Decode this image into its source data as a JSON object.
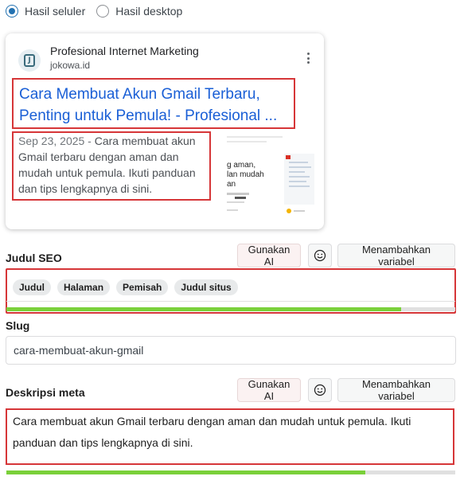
{
  "preview_mode": {
    "mobile_label": "Hasil seluler",
    "desktop_label": "Hasil desktop",
    "selected": "mobile"
  },
  "serp_card": {
    "site_name": "Profesional Internet Marketing",
    "site_url": "jokowa.id",
    "favicon_glyph": "J",
    "title": "Cara Membuat Akun Gmail Terbaru, Penting untuk Pemula! - Profesional ...",
    "date": "Sep 23, 2025",
    "separator": " - ",
    "description": "Cara membuat akun Gmail terbaru dengan aman dan mudah untuk pemula. Ikuti panduan dan tips lengkapnya di sini.",
    "thumb_lines": [
      "g aman,",
      "lan mudah",
      "an"
    ]
  },
  "seo_title": {
    "label": "Judul SEO",
    "ai_button": "Gunakan AI",
    "variable_button": "Menambahkan variabel",
    "tags": [
      "Judul",
      "Halaman",
      "Pemisah",
      "Judul situs"
    ],
    "progress": 0.88,
    "progress_color": "#7ad03a"
  },
  "slug": {
    "label": "Slug",
    "value": "cara-membuat-akun-gmail"
  },
  "meta_description": {
    "label": "Deskripsi meta",
    "ai_button": "Gunakan AI",
    "variable_button": "Menambahkan variabel",
    "value": "Cara membuat akun Gmail terbaru dengan aman dan mudah untuk pemula. Ikuti panduan dan tips lengkapnya di sini.",
    "progress": 0.8,
    "progress_color": "#7ad03a"
  },
  "colors": {
    "highlight_border": "#d63638",
    "link_blue": "#1a5fd6",
    "radio_accent": "#2271b1"
  }
}
